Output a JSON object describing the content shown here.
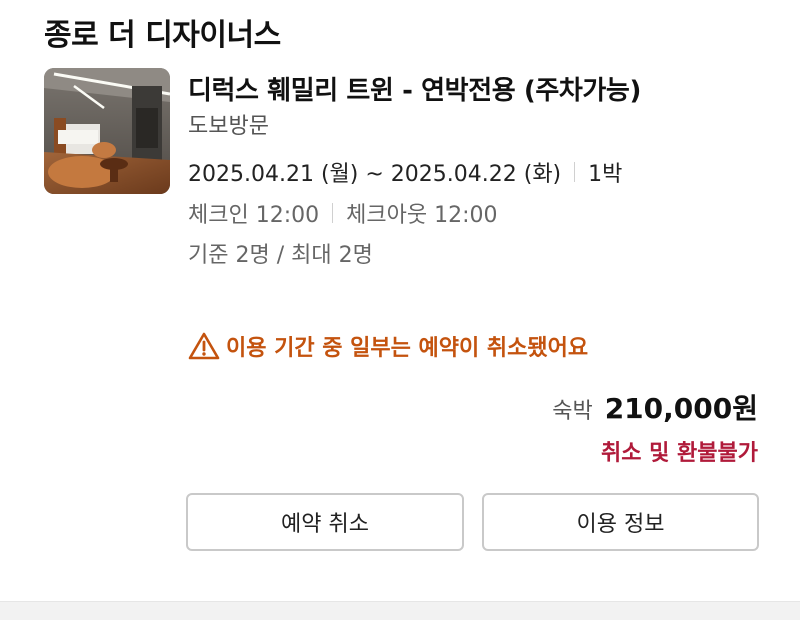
{
  "hotel": {
    "name": "종로 더 디자이너스"
  },
  "room": {
    "title": "디럭스 훼밀리 트윈 - 연박전용 (주차가능)",
    "visit_type": "도보방문",
    "check_in_date": "2025.04.21 (월) ~ 2025.04.22 (화)",
    "nights": "1박",
    "check_in_time": "체크인 12:00",
    "check_out_time": "체크아웃 12:00",
    "capacity": "기준 2명 / 최대 2명",
    "thumbnail_icon": "room-photo"
  },
  "warning": {
    "icon": "warning-triangle-icon",
    "text": "이용 기간 중 일부는 예약이 취소됐어요",
    "color": "#c4530e"
  },
  "price": {
    "label": "숙박",
    "amount": "210,000원",
    "refund_policy": "취소 및 환불불가",
    "refund_color": "#b01a3a"
  },
  "actions": {
    "cancel_label": "예약 취소",
    "info_label": "이용 정보"
  }
}
